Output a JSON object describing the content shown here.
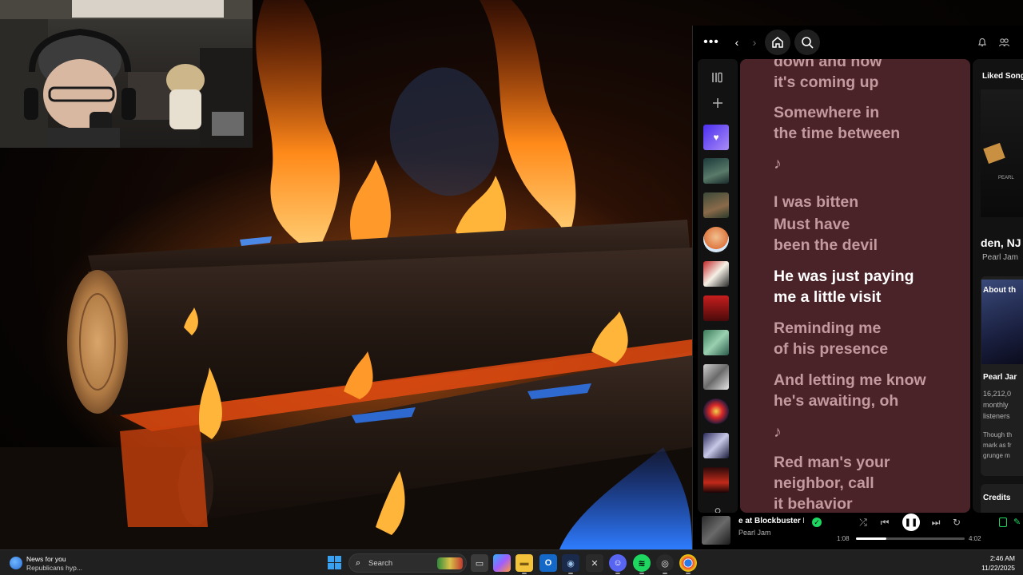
{
  "spotify": {
    "topbar": {
      "more_label": "•••",
      "back_label": "‹",
      "forward_label": "›"
    },
    "library": {
      "icons": [
        "library-icon",
        "plus-icon"
      ]
    },
    "lyrics": [
      {
        "text": "down and now\nit's coming up",
        "active": false
      },
      {
        "text": "Somewhere in\nthe time between",
        "active": false
      },
      {
        "text": "♪",
        "active": false
      },
      {
        "text": "I was bitten",
        "active": false
      },
      {
        "text": "Must have\nbeen the devil",
        "active": false
      },
      {
        "text": "He was just paying\nme a little visit",
        "active": true
      },
      {
        "text": "Reminding me\nof his presence",
        "active": false
      },
      {
        "text": "And letting me know\nhe's awaiting, oh",
        "active": false
      },
      {
        "text": "♪",
        "active": false
      },
      {
        "text": "Red man's your\nneighbor, call\nit behavior",
        "active": false
      }
    ],
    "right_panel": {
      "header": "Liked Song",
      "album_label": "PEARL",
      "location": "den, NJ",
      "artist": "Pearl Jam",
      "about_label": "About th",
      "about_artist": "Pearl Jar",
      "listeners_number": "16,212,0",
      "listeners_line1": "monthly",
      "listeners_line2": "listeners",
      "bio_line1": "Though th",
      "bio_line2": "mark as fr",
      "bio_line3": "grunge m",
      "credits_label": "Credits"
    },
    "player": {
      "track_title": "e at Blockbuster M",
      "artist": "Pearl Jam",
      "current_time": "1:08",
      "total_time": "4:02",
      "progress": 0.28,
      "shuffle_label": "⤮",
      "prev_label": "⏮",
      "play_label": "❚❚",
      "next_label": "⏭",
      "repeat_label": "↻"
    },
    "accent": "#1ed760",
    "lyrics_bg": "#4a2329"
  },
  "taskbar": {
    "news_title": "News for you",
    "news_subtitle": "Republicans hyp...",
    "search_label": "Search",
    "apps": [
      "file-explorer-icon",
      "copilot-icon",
      "folder-icon",
      "outlook-icon",
      "steam-icon",
      "xbox-icon",
      "discord-icon",
      "spotify-icon",
      "obs-icon",
      "chrome-icon"
    ],
    "time": "2:46 AM",
    "date": "11/22/2025"
  }
}
